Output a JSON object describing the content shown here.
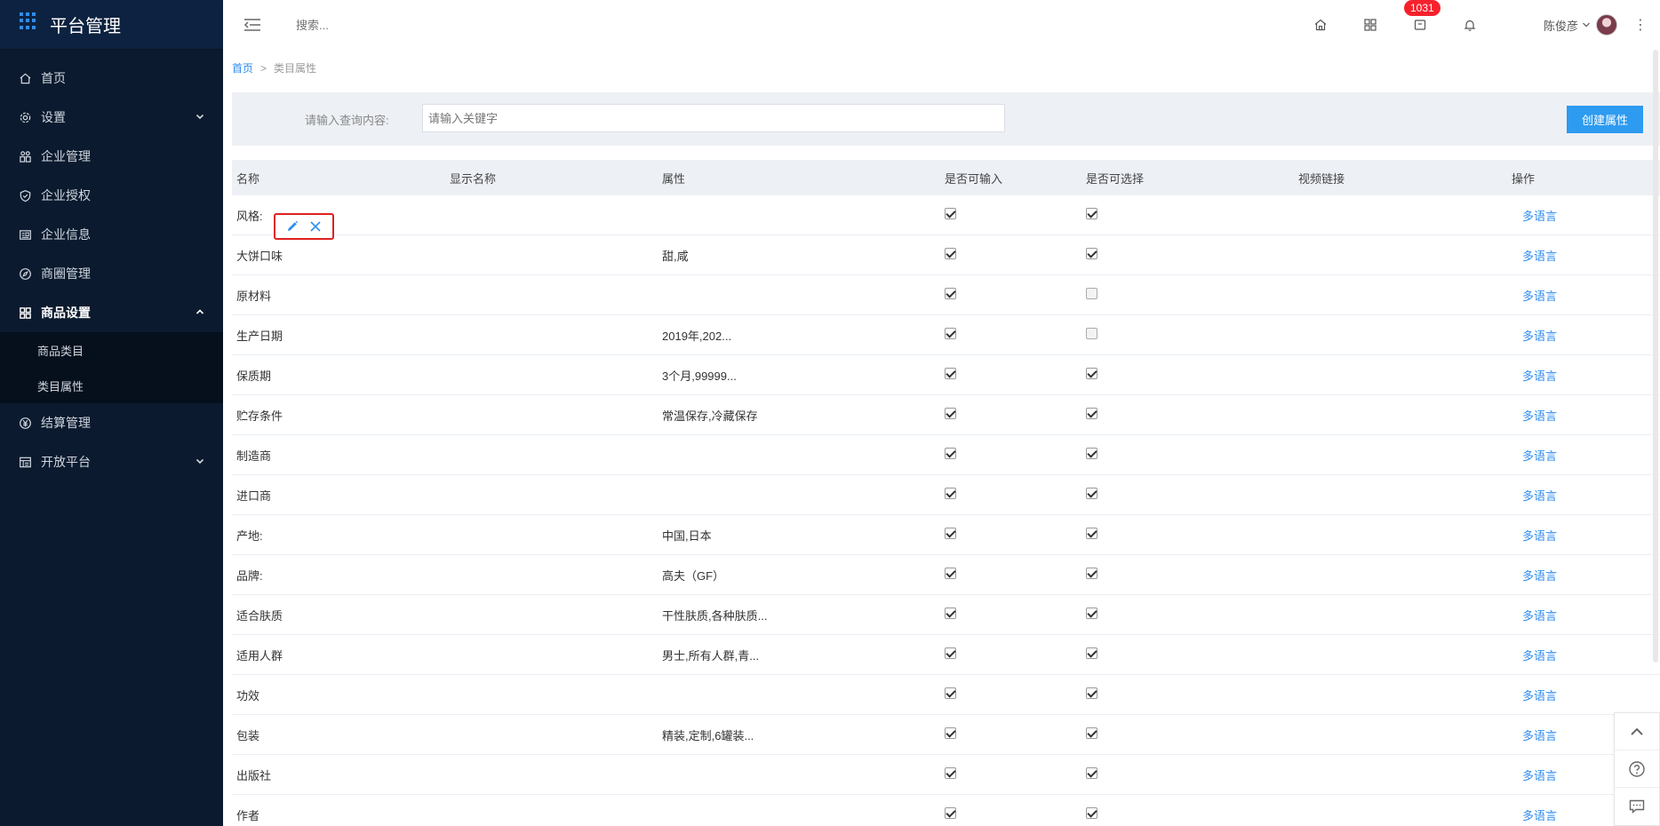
{
  "brand": {
    "title": "平台管理"
  },
  "sidebar": {
    "items": [
      {
        "label": "首页",
        "icon": "home-icon"
      },
      {
        "label": "设置",
        "icon": "settings-icon",
        "expandable": true
      },
      {
        "label": "企业管理",
        "icon": "enterprise-icon"
      },
      {
        "label": "企业授权",
        "icon": "shield-icon"
      },
      {
        "label": "企业信息",
        "icon": "info-card-icon"
      },
      {
        "label": "商圈管理",
        "icon": "compass-icon"
      },
      {
        "label": "商品设置",
        "icon": "grid-icon",
        "expanded": true
      },
      {
        "label": "结算管理",
        "icon": "yen-icon"
      },
      {
        "label": "开放平台",
        "icon": "table-icon",
        "expandable": true
      }
    ],
    "sub_items": [
      {
        "label": "商品类目"
      },
      {
        "label": "类目属性"
      }
    ]
  },
  "topbar": {
    "search_placeholder": "搜索...",
    "badge_count": "1031",
    "user_name": "陈俊彦",
    "more": "⋮"
  },
  "breadcrumb": {
    "home": "首页",
    "sep": ">",
    "current": "类目属性"
  },
  "filter": {
    "label": "请输入查询内容:",
    "input_placeholder": "请输入关键字",
    "create_button": "创建属性"
  },
  "table": {
    "headers": [
      "名称",
      "显示名称",
      "属性",
      "是否可输入",
      "是否可选择",
      "视频链接",
      "操作"
    ],
    "action_label": "多语言",
    "rows": [
      {
        "name": "风格:",
        "display": "",
        "attr": "",
        "input": true,
        "select": true,
        "video": ""
      },
      {
        "name": "大饼口味",
        "display": "",
        "attr": "甜,咸",
        "input": true,
        "select": true,
        "video": ""
      },
      {
        "name": "原材料",
        "display": "",
        "attr": "",
        "input": true,
        "select": false,
        "video": ""
      },
      {
        "name": "生产日期",
        "display": "",
        "attr": "2019年,202...",
        "input": true,
        "select": false,
        "video": ""
      },
      {
        "name": "保质期",
        "display": "",
        "attr": "3个月,99999...",
        "input": true,
        "select": true,
        "video": ""
      },
      {
        "name": "贮存条件",
        "display": "",
        "attr": "常温保存,冷藏保存",
        "input": true,
        "select": true,
        "video": ""
      },
      {
        "name": "制造商",
        "display": "",
        "attr": "",
        "input": true,
        "select": true,
        "video": ""
      },
      {
        "name": "进口商",
        "display": "",
        "attr": "",
        "input": true,
        "select": true,
        "video": ""
      },
      {
        "name": "产地:",
        "display": "",
        "attr": "中国,日本",
        "input": true,
        "select": true,
        "video": ""
      },
      {
        "name": "品牌:",
        "display": "",
        "attr": "高夫（GF）",
        "input": true,
        "select": true,
        "video": ""
      },
      {
        "name": "适合肤质",
        "display": "",
        "attr": "干性肤质,各种肤质...",
        "input": true,
        "select": true,
        "video": ""
      },
      {
        "name": "适用人群",
        "display": "",
        "attr": "男士,所有人群,青...",
        "input": true,
        "select": true,
        "video": ""
      },
      {
        "name": "功效",
        "display": "",
        "attr": "",
        "input": true,
        "select": true,
        "video": ""
      },
      {
        "name": "包装",
        "display": "",
        "attr": "精装,定制,6罐装...",
        "input": true,
        "select": true,
        "video": ""
      },
      {
        "name": "出版社",
        "display": "",
        "attr": "",
        "input": true,
        "select": true,
        "video": ""
      },
      {
        "name": "作者",
        "display": "",
        "attr": "",
        "input": true,
        "select": true,
        "video": ""
      }
    ]
  },
  "colors": {
    "sidebar_bg": "#0b1a2e",
    "accent": "#2d9bf0",
    "badge": "#f5222d",
    "highlight_border": "#e02020"
  }
}
